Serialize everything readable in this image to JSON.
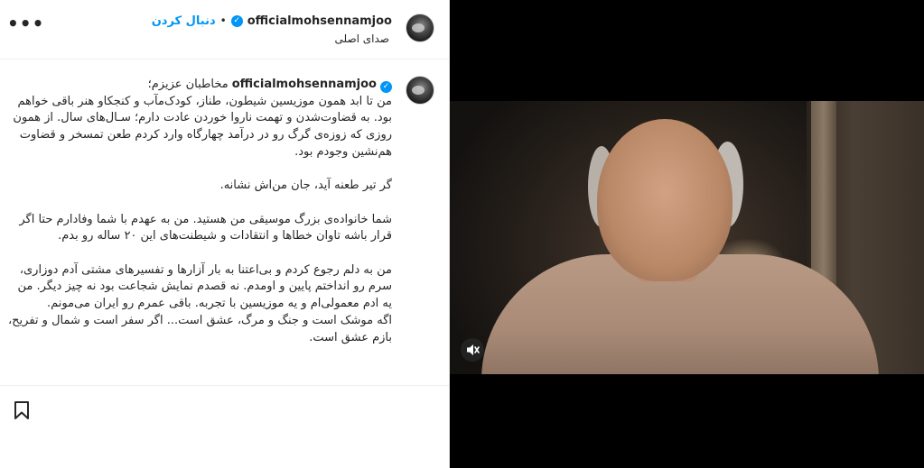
{
  "post": {
    "username": "officialmohsennamjoo",
    "verified_mark": "✓",
    "separator": "•",
    "follow_label": "دنبال کردن",
    "audio_label": "صدای اصلی",
    "more_label": "•••"
  },
  "caption": {
    "username": "officialmohsennamjoo",
    "text": "مخاطبان عزیزم؛\nمن تا ابد همون موزیسین شیطون، طناز، کودک‌مآب و کنجکاو هنر باقی خواهم بود. به قضاوت‌شدن و تهمت ناروا خوردن عادت دارم؛ سـال‌های سال. از همون روزی که زوزه‌ی گرگ رو در درآمد چهارگاه وارد کردم طعن تمسخر و قضاوت هم‌نشین وجودم بود.\n\nگر تیر طعنه آید، جان من‌اش نشانه.\n\nشما خانواده‌ی بزرگ موسیقی من هستید. من به عهدم با شما وفادارم حتا اگر قرار باشه تاوان خطاها و انتقادات و شیطنت‌های این ۲۰ ساله رو بدم.\n\nمن به دلم رجوع کردم و بی‌اعتنا به بار آزارها و تفسیرهای مشتی آدم دوزاری، سرم رو انداختم پایین و اومدم. نه قصدم نمایش شجاعت بود نه چیز دیگر. من یه ادم معمولی‌ام و یه موزیسین با تجربه. باقی عمرم رو ایران می‌مونم.\nاگه موشک است و جنگ و مرگ، عشق است... اگر سفر است و شمال و تفریح، بازم عشق است."
  },
  "icons": {
    "more": "more-options-icon",
    "bookmark": "bookmark-icon",
    "mute": "muted-speaker-icon",
    "verified": "verified-badge-icon"
  },
  "colors": {
    "accent": "#0095f6",
    "text": "#262626",
    "video_bg": "#000000"
  }
}
